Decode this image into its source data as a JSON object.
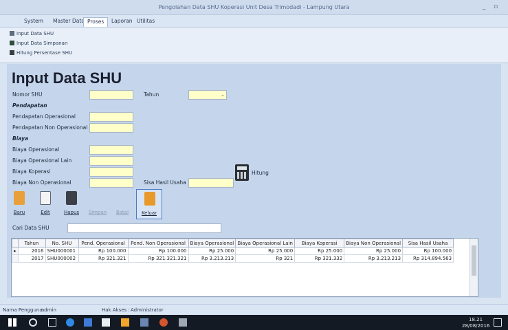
{
  "window": {
    "title": "Pengolahan Data SHU Koperasi Unit Desa Trimodadi - Lampung Utara",
    "minimize": "_",
    "maximize": "▫"
  },
  "menu": [
    "System",
    "Master Data",
    "Proses",
    "Laporan",
    "Utilitas"
  ],
  "ribbon": [
    "Input Data SHU",
    "Input Data Simpanan",
    "Hitung Persentase SHU"
  ],
  "page_title": "Input Data SHU",
  "form": {
    "nomor_shu": "Nomor SHU",
    "tahun": "Tahun",
    "pendapatan": "Pendapatan",
    "pend_operasional": "Pendapatan Operasional",
    "pend_non_operasional": "Pendapatan Non Operasional",
    "biaya": "Biaya",
    "biaya_operasional": "Biaya Operasional",
    "biaya_operasional_lain": "Biaya Operasional Lain",
    "biaya_koperasi": "Biaya Koperasi",
    "biaya_non_operasional": "Biaya Non Operasional",
    "sisa_hasil_usaha": "Sisa Hasil Usaha",
    "hitung": "Hitung"
  },
  "toolbar": [
    "Baru",
    "Edit",
    "Hapus",
    "Simpan",
    "Batal",
    "Keluar"
  ],
  "search": {
    "label": "Cari Data SHU",
    "value": ""
  },
  "table": {
    "columns": [
      "Tahun",
      "No. SHU",
      "Pend. Operasional",
      "Pend. Non Operasional",
      "Biaya Operasional",
      "Biaya Operasional Lain",
      "Biaya Koperasi",
      "Biaya Non Operasional",
      "Sisa Hasil Usaha"
    ],
    "rows": [
      [
        "2016",
        "SHU000001",
        "Rp 100.000",
        "Rp 100.000",
        "Rp 25.000",
        "Rp 25.000",
        "Rp 25.000",
        "Rp 25.000",
        "Rp 100.000"
      ],
      [
        "2017",
        "SHU000002",
        "Rp 321.321",
        "Rp 321.321.321",
        "Rp 3.213.213",
        "Rp 321",
        "Rp 321.332",
        "Rp 3.213.213",
        "Rp 314.894.563"
      ]
    ]
  },
  "status": {
    "user_label": "Nama Pengguna :",
    "user": "admin",
    "access_label": "Hak Akses :",
    "access": "Administrator"
  },
  "taskbar": {
    "time": "18.21",
    "date": "28/08/2016"
  },
  "colors": {
    "input_bg": "#ffffc9",
    "content_bg": "#c5d5eb"
  }
}
